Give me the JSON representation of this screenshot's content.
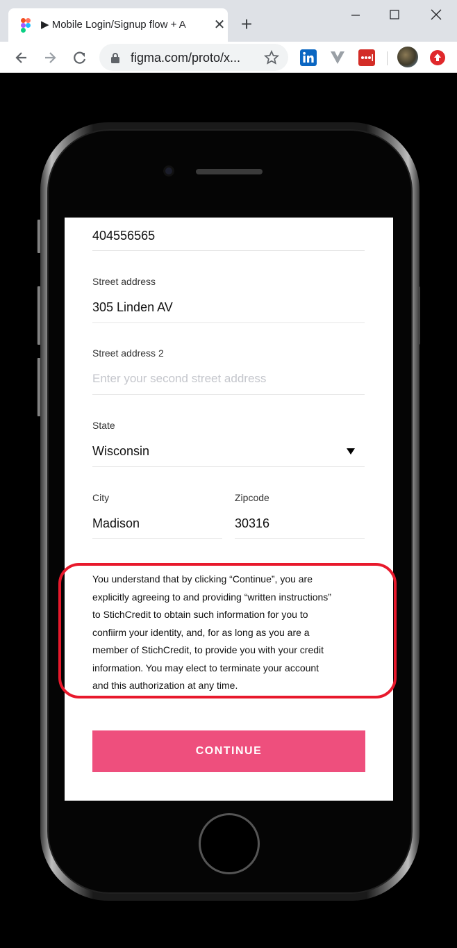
{
  "browser": {
    "tab_title": "▶ Mobile Login/Signup flow + A",
    "url": "figma.com/proto/x..."
  },
  "form": {
    "phone_value": "404556565",
    "street_label": "Street address",
    "street_value": "305 Linden AV",
    "street2_label": "Street address 2",
    "street2_placeholder": "Enter your second street address",
    "state_label": "State",
    "state_value": "Wisconsin",
    "city_label": "City",
    "city_value": "Madison",
    "zip_label": "Zipcode",
    "zip_value": "30316"
  },
  "disclaimer": {
    "line1": "You understand that by clicking “Continue”, you are",
    "line2": "explicitly agreeing to and providing “written instructions”",
    "line3": "to StichCredit to obtain such information for you to",
    "line4": "confiirm your identity, and, for as long as you are a",
    "line5": "member of StichCredit, to provide you with your credit",
    "line6": "information. You may elect to terminate your account",
    "line7": "and this authorization at any time."
  },
  "continue_label": "CONTINUE",
  "colors": {
    "accent": "#ee4f7d",
    "highlight": "#e8192c"
  },
  "icons": {
    "favicon": "figma-icon",
    "close": "close-icon",
    "new_tab": "plus-icon",
    "back": "arrow-left-icon",
    "forward": "arrow-right-icon",
    "reload": "reload-icon",
    "lock": "lock-icon",
    "star": "star-icon",
    "ext1": "linkedin-icon",
    "ext2": "v-icon",
    "ext3": "lastpass-icon",
    "ext4": "upload-icon"
  }
}
